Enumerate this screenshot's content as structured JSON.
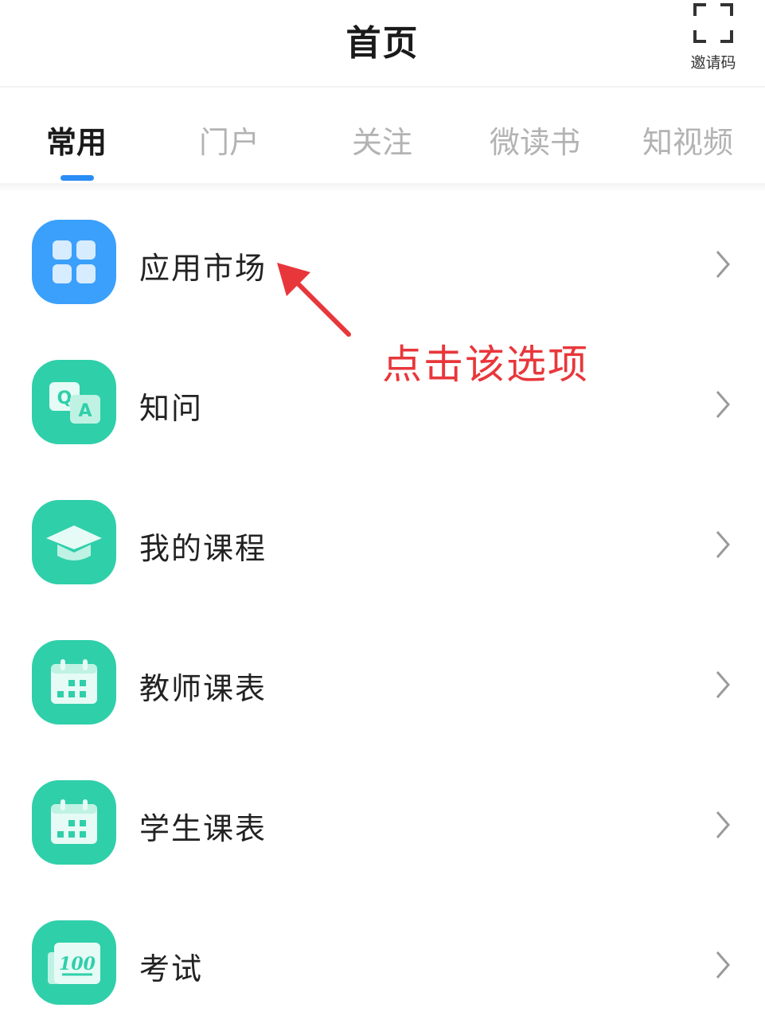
{
  "header": {
    "title": "首页",
    "invite_label": "邀请码",
    "invite_icon": "scan-frame-icon"
  },
  "tabs": [
    {
      "label": "常用",
      "active": true
    },
    {
      "label": "门户",
      "active": false
    },
    {
      "label": "关注",
      "active": false
    },
    {
      "label": "微读书",
      "active": false
    },
    {
      "label": "知视频",
      "active": false
    }
  ],
  "items": [
    {
      "label": "应用市场",
      "icon": "app-grid-icon",
      "color": "#3aa0fb"
    },
    {
      "label": "知问",
      "icon": "qa-icon",
      "color": "#2fcfaa"
    },
    {
      "label": "我的课程",
      "icon": "graduation-cap-icon",
      "color": "#2fcfaa"
    },
    {
      "label": "教师课表",
      "icon": "calendar-icon",
      "color": "#2fcfaa"
    },
    {
      "label": "学生课表",
      "icon": "calendar-icon",
      "color": "#2fcfaa"
    },
    {
      "label": "考试",
      "icon": "exam-100-icon",
      "color": "#2fcfaa",
      "icon_text": "100"
    }
  ],
  "annotation": {
    "text": "点击该选项",
    "color": "#e8373b"
  },
  "colors": {
    "accent": "#2a8cf5",
    "inactive_tab": "#b3b3b3"
  }
}
